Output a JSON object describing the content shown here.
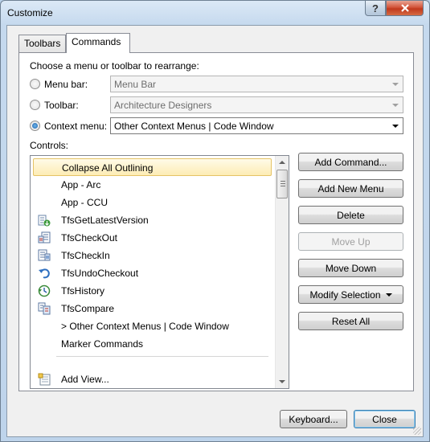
{
  "window": {
    "title": "Customize",
    "help_label": "?",
    "close_label": "x"
  },
  "tabs": [
    {
      "label": "Toolbars"
    },
    {
      "label": "Commands"
    }
  ],
  "prompt": "Choose a menu or toolbar to rearrange:",
  "options": {
    "menu_bar": {
      "label": "Menu bar:",
      "value": "Menu Bar",
      "checked": false
    },
    "toolbar": {
      "label": "Toolbar:",
      "value": "Architecture Designers",
      "checked": false
    },
    "context_menu": {
      "label": "Context menu:",
      "value": "Other Context Menus | Code Window",
      "checked": true
    }
  },
  "controls_label": "Controls:",
  "controls": [
    {
      "label": "Collapse All Outlining",
      "icon": "none",
      "selected": true
    },
    {
      "label": "App - Arc",
      "icon": "none"
    },
    {
      "label": "App - CCU",
      "icon": "none"
    },
    {
      "label": "TfsGetLatestVersion",
      "icon": "get-latest-icon"
    },
    {
      "label": "TfsCheckOut",
      "icon": "checkout-icon"
    },
    {
      "label": "TfsCheckIn",
      "icon": "checkin-icon"
    },
    {
      "label": "TfsUndoCheckout",
      "icon": "undo-icon"
    },
    {
      "label": "TfsHistory",
      "icon": "history-icon"
    },
    {
      "label": "TfsCompare",
      "icon": "compare-icon"
    },
    {
      "label": "> Other Context Menus | Code Window",
      "icon": "none"
    },
    {
      "label": "Marker Commands",
      "icon": "none"
    },
    {
      "label": "Add View...",
      "icon": "add-view-icon"
    }
  ],
  "buttons": {
    "add_command": "Add Command...",
    "add_new_menu": "Add New Menu",
    "delete": "Delete",
    "move_up": "Move Up",
    "move_down": "Move Down",
    "modify_selection": "Modify Selection",
    "reset_all": "Reset All",
    "keyboard": "Keyboard...",
    "close": "Close"
  }
}
